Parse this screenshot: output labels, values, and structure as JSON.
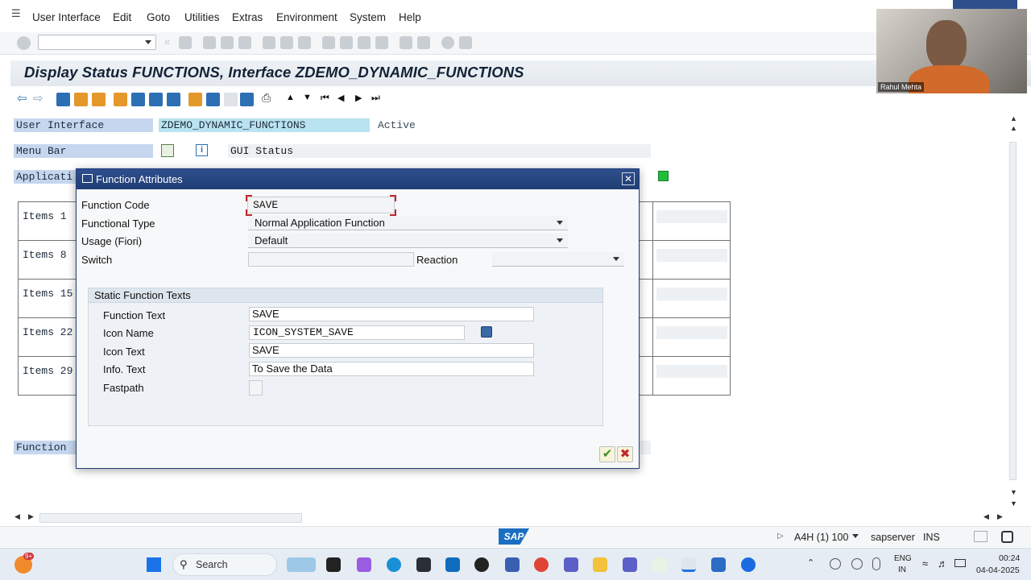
{
  "menu": {
    "items": [
      "User Interface",
      "Edit",
      "Goto",
      "Utilities",
      "Extras",
      "Environment",
      "System",
      "Help"
    ]
  },
  "title": "Display Status FUNCTIONS, Interface ZDEMO_DYNAMIC_FUNCTIONS",
  "main": {
    "user_interface_label": "User Interface",
    "user_interface_value": "ZDEMO_DYNAMIC_FUNCTIONS",
    "status_text": "Active",
    "menu_bar_label": "Menu Bar",
    "gui_status_text": "GUI Status",
    "application_label": "Applicati",
    "items": [
      "Items  1",
      "Items  8",
      "Items 15",
      "Items 22",
      "Items 29"
    ],
    "function_label": "Function"
  },
  "dialog": {
    "title": "Function Attributes",
    "function_code_label": "Function Code",
    "function_code_value": "SAVE",
    "functional_type_label": "Functional Type",
    "functional_type_value": "Normal Application Function",
    "usage_label": "Usage (Fiori)",
    "usage_value": "Default",
    "switch_label": "Switch",
    "reaction_label": "Reaction",
    "group_title": "Static Function Texts",
    "function_text_label": "Function Text",
    "function_text_value": "SAVE",
    "icon_name_label": "Icon Name",
    "icon_name_value": "ICON_SYSTEM_SAVE",
    "icon_text_label": "Icon Text",
    "icon_text_value": "SAVE",
    "info_text_label": "Info. Text",
    "info_text_value": "To Save the Data",
    "fastpath_label": "Fastpath"
  },
  "statusbar": {
    "system": "A4H (1) 100",
    "server": "sapserver",
    "mode": "INS",
    "logo": "SAP"
  },
  "video": {
    "name": "Rahul Mehta"
  },
  "taskbar": {
    "search_placeholder": "Search",
    "language_line1": "ENG",
    "language_line2": "IN",
    "time": "00:24",
    "date": "04-04-2025",
    "badge": "9+"
  },
  "colors": {
    "dialog_header": "#2e4f8c",
    "label_highlight": "#c5d7ee",
    "value_highlight": "#b9e3f0",
    "status_green": "#1fbf3a"
  }
}
